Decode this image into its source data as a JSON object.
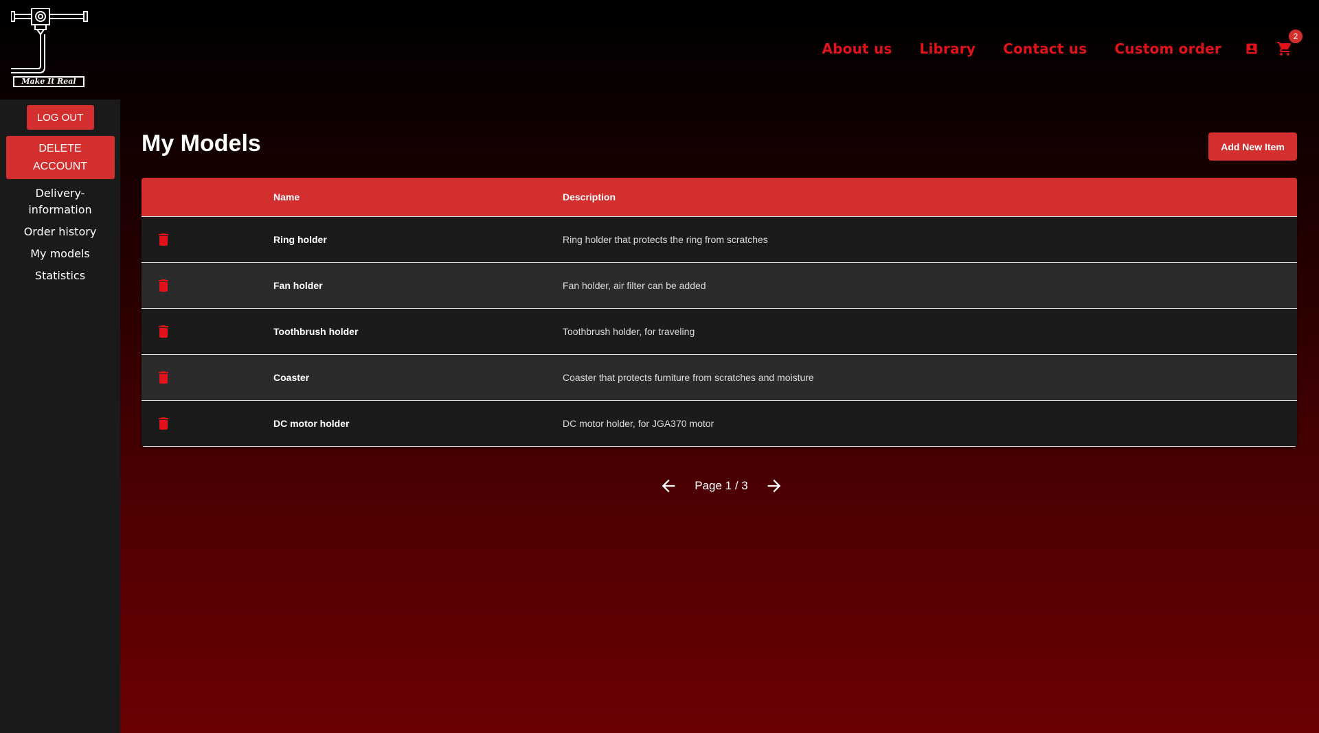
{
  "brand": {
    "logo_text": "Make It Real"
  },
  "nav": {
    "links": [
      "About us",
      "Library",
      "Contact us",
      "Custom order"
    ],
    "cart_count": "2",
    "account_icon": "account-box-icon",
    "cart_icon": "shopping-cart-icon"
  },
  "sidebar": {
    "logout_label": "LOG OUT",
    "delete_label": "DELETE ACCOUNT",
    "items": [
      "Delivery-information",
      "Order history",
      "My models",
      "Statistics"
    ]
  },
  "main": {
    "title": "My Models",
    "add_label": "Add New Item"
  },
  "table": {
    "headers": {
      "name": "Name",
      "description": "Description"
    },
    "rows": [
      {
        "name": "Ring holder",
        "description": "Ring holder that protects the ring from scratches"
      },
      {
        "name": "Fan holder",
        "description": "Fan holder, air filter can be added"
      },
      {
        "name": "Toothbrush holder",
        "description": "Toothbrush holder, for traveling"
      },
      {
        "name": "Coaster",
        "description": "Coaster that protects furniture from scratches and moisture"
      },
      {
        "name": "DC motor holder",
        "description": "DC motor holder, for JGA370 motor"
      }
    ],
    "row_icon": "trash-icon"
  },
  "pagination": {
    "label": "Page 1 / 3"
  },
  "colors": {
    "accent": "#d32f2f",
    "nav_red": "#e11219",
    "sidebar_bg": "#1a1a1a",
    "row_bg": "#1b1b1b",
    "row_alt_bg": "#2b2b2b"
  }
}
